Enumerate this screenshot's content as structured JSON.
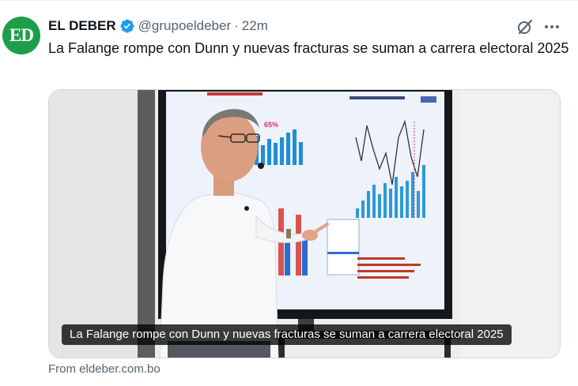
{
  "author": {
    "avatar_text": "ED",
    "name": "EL DEBER",
    "handle": "@grupoeldeber",
    "separator": "·",
    "time": "22m"
  },
  "tweet": {
    "text": "La Falange rompe con Dunn y nuevas fracturas se suman a carrera electoral 2025"
  },
  "media": {
    "caption": "La Falange rompe con Dunn y nuevas fracturas se suman a carrera electoral 2025"
  },
  "card": {
    "source": "From eldeber.com.bo"
  },
  "icons": {
    "verified": "verified-badge-icon",
    "grok": "grok-icon",
    "more": "more-icon"
  },
  "colors": {
    "brand_green": "#1e9e4a",
    "verified_blue": "#1d9bf0",
    "secondary_text": "#536471"
  }
}
